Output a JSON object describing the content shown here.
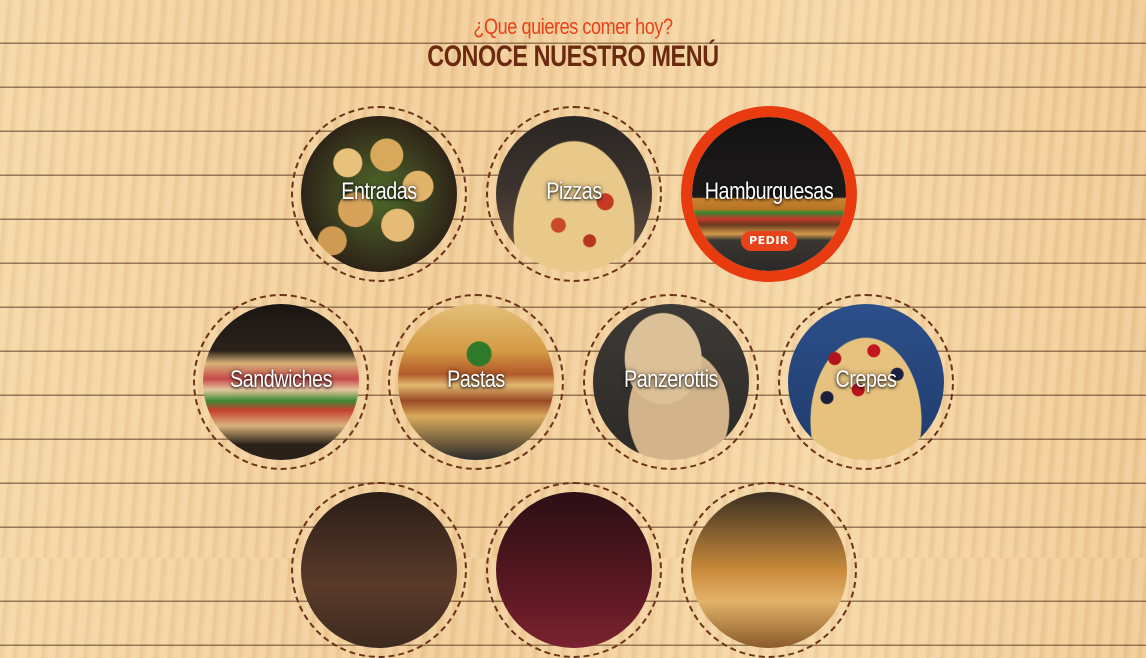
{
  "header": {
    "subtitle": "¿Que quieres comer hoy?",
    "title": "CONOCE NUESTRO MENÚ"
  },
  "menu": {
    "categories": [
      {
        "label": "Entradas",
        "active": false
      },
      {
        "label": "Pizzas",
        "active": false
      },
      {
        "label": "Hamburguesas",
        "active": true,
        "button": "PEDIR"
      },
      {
        "label": "Sandwiches",
        "active": false
      },
      {
        "label": "Pastas",
        "active": false
      },
      {
        "label": "Panzerottis",
        "active": false
      },
      {
        "label": "Crepes",
        "active": false
      }
    ]
  },
  "colors": {
    "accent": "#e8421b",
    "title": "#6b2a10",
    "ring": "#6b3418"
  }
}
